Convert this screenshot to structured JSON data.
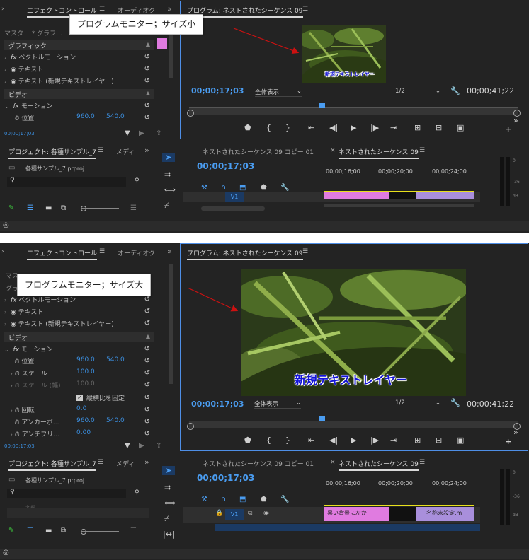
{
  "panel_tabs": {
    "effect_controls": "エフェクトコントロール",
    "audio": "オーディオク",
    "program": "プログラム: ネストされたシーケンス 09",
    "project": "プロジェクト: 各種サンプル_7",
    "media": "メディ",
    "seq_copy": "ネストされたシーケンス 09 コピー 01",
    "seq_active": "ネストされたシーケンス 09"
  },
  "screenshot1": {
    "callout": "プログラムモニター；サイズ小",
    "master": "マスター * グラフ...",
    "graphic_section": "グラフィック",
    "rows": {
      "vector_motion": "ベクトルモーション",
      "text": "テキスト",
      "text_layer": "テキスト (新規テキストレイヤー)"
    },
    "video_section": "ビデオ",
    "motion": "モーション",
    "position_label": "位置",
    "position_x": "960.0",
    "position_y": "540.0",
    "ec_timecode": "00;00;17;03",
    "overlay_text": "新規テキストレイヤー",
    "program_timecode": "00;00;17;03",
    "fit": "全体表示",
    "resolution": "1/2",
    "duration": "00;00;41;22",
    "project_file": "各種サンプル_7.prproj",
    "seq_timecode": "00;00;17;03",
    "ruler": [
      "00;00;16;00",
      "00;00;20;00",
      "00;00;24;00"
    ],
    "track_v1": "V1",
    "meter": [
      "0",
      "-36",
      "dB"
    ]
  },
  "screenshot2": {
    "callout": "プログラムモニター；サイズ大",
    "master": "マス",
    "section_fragment": "グラ",
    "rows": {
      "vector_motion": "ベクトルモーション",
      "text": "テキスト",
      "text_layer": "テキスト (新規テキストレイヤー)"
    },
    "video_section": "ビデオ",
    "motion": "モーション",
    "position_label": "位置",
    "position_x": "960.0",
    "position_y": "540.0",
    "scale_label": "スケール",
    "scale_value": "100.0",
    "scale_w_label": "スケール (幅)",
    "scale_w_value": "100.0",
    "uniform_scale": "縦横比を固定",
    "rotation_label": "回転",
    "rotation_value": "0.0",
    "anchor_label": "アンカーポ...",
    "anchor_x": "960.0",
    "anchor_y": "540.0",
    "anti_flicker_label": "アンチフリ...",
    "anti_flicker_value": "0.00",
    "ec_timecode": "00;00;17;03",
    "overlay_text": "新規テキストレイヤー",
    "program_timecode": "00;00;17;03",
    "fit": "全体表示",
    "resolution": "1/2",
    "duration": "00;00;41;22",
    "project_file": "各種サンプル_7.prproj",
    "project_fragment": "名前",
    "seq_timecode": "00;00;17;03",
    "ruler": [
      "00;00;16;00",
      "00;00;20;00",
      "00;00;24;00"
    ],
    "track_v1": "V1",
    "clip1": "黒い背景に左か",
    "clip2": "名称未設定.m",
    "meter": [
      "0",
      "-36",
      "dB"
    ]
  },
  "colors": {
    "accent_blue": "#4a9cf0",
    "callout_arrow": "#cc1111",
    "clip_pink": "#e07be0",
    "clip_purple": "#a98fdc",
    "overlay_text": "#1414d8"
  }
}
